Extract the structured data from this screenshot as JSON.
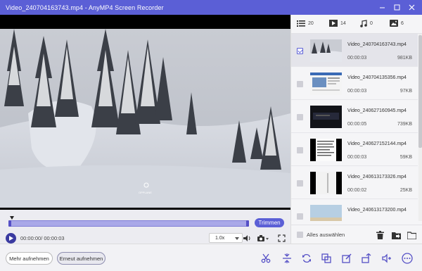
{
  "app": {
    "window_title": "Video_240704163743.mp4  -  AnyMP4 Screen Recorder"
  },
  "player": {
    "overlay_text": "OPPLANE",
    "time_display": "00:00:00/ 00:00:03",
    "speed": "1.0x",
    "trim_label": "Trimmen"
  },
  "tabs": [
    {
      "icon": "list-icon",
      "count": "20"
    },
    {
      "icon": "video-icon",
      "count": "14"
    },
    {
      "icon": "music-icon",
      "count": "0"
    },
    {
      "icon": "image-icon",
      "count": "6"
    }
  ],
  "files": [
    {
      "name": "Video_240704163743.mp4",
      "duration": "00:00:03",
      "size": "981KB",
      "checked": true
    },
    {
      "name": "Video_240704135356.mp4",
      "duration": "00:00:03",
      "size": "97KB",
      "checked": false
    },
    {
      "name": "Video_240627160945.mp4",
      "duration": "00:00:05",
      "size": "739KB",
      "checked": false
    },
    {
      "name": "Video_240627152144.mp4",
      "duration": "00:00:03",
      "size": "59KB",
      "checked": false
    },
    {
      "name": "Video_240613173326.mp4",
      "duration": "00:00:02",
      "size": "25KB",
      "checked": false
    },
    {
      "name": "Video_240613173200.mp4",
      "duration": "",
      "size": "",
      "checked": false
    }
  ],
  "list_footer": {
    "select_all": "Alles auswählen"
  },
  "bottom": {
    "record_more": "Mehr aufnehmen",
    "record_again": "Erneut aufnehmen"
  },
  "colors": {
    "accent": "#5b5fd6",
    "title_bar": "#5b5fd6"
  }
}
